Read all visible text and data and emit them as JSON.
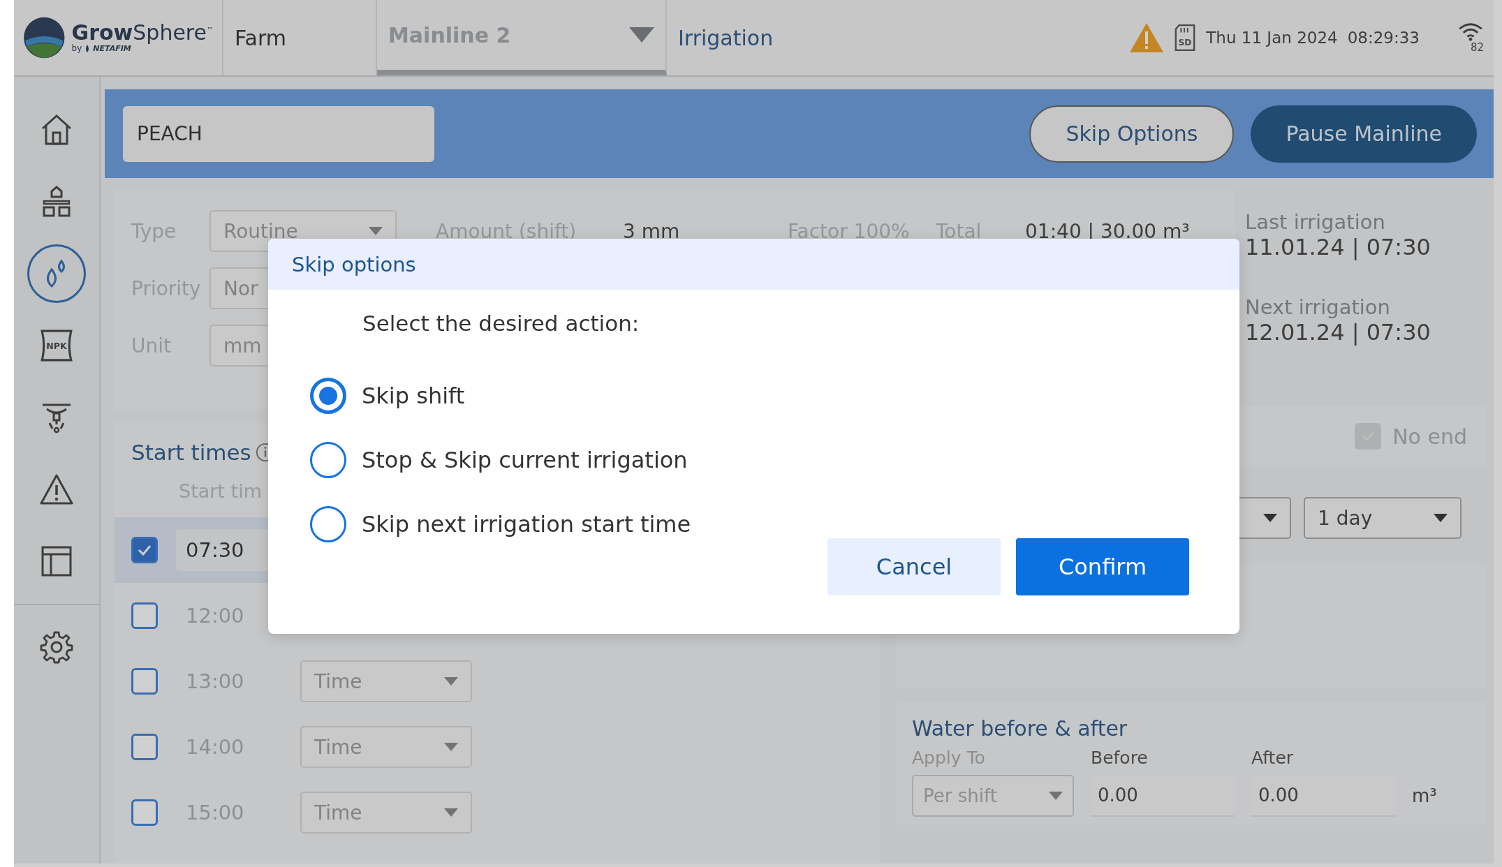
{
  "topbar": {
    "brand": "**Grow**Sphere$^{™}$",
    "brand_by": "by",
    "brand_maker": "NETAFIM",
    "farm": "Farm",
    "mainline": "Mainline 2",
    "section": "Irrigation",
    "alert": true,
    "storage_label": "SD",
    "date": "Thu 11 Jan 2024",
    "time": "08:29:33",
    "signal": "82"
  },
  "sidebar": {
    "items": [
      {
        "kind": "home",
        "selected": false
      },
      {
        "kind": "hierarchy",
        "selected": false
      },
      {
        "kind": "irrigation",
        "selected": true
      },
      {
        "kind": "npk",
        "label": "NPK",
        "selected": false
      },
      {
        "kind": "sprinkler",
        "selected": false
      },
      {
        "kind": "alert",
        "selected": false
      },
      {
        "kind": "table",
        "selected": false
      },
      {
        "kind": "settings",
        "selected": false
      }
    ]
  },
  "header": {
    "program_name": "PEACH",
    "buttons": [
      {
        "label": "Skip Options",
        "kind": "outline"
      },
      {
        "label": "Pause Mainline",
        "kind": "filled"
      }
    ]
  },
  "settings": {
    "fields": [
      {
        "label": "Type",
        "value": "Routine"
      },
      {
        "label": "Priority",
        "value": "Nor"
      },
      {
        "label": "Unit",
        "value": "mm"
      }
    ],
    "amount": {
      "label": "Amount (shift)",
      "value": "3 mm"
    },
    "factor": "Factor 100%",
    "total": {
      "label": "Total",
      "value": "01:40 | 30.00 m³"
    },
    "last_irrigation": {
      "label": "Last irrigation",
      "value": "11.01.24 | 07:30"
    },
    "next_irrigation": {
      "label": "Next irrigation",
      "value": "12.01.24 | 07:30"
    }
  },
  "start_times": {
    "title": "Start times",
    "column": "Start tim",
    "rows": [
      {
        "time": "07:30",
        "checked": true
      },
      {
        "time": "12:00",
        "checked": false
      },
      {
        "time": "13:00",
        "checked": false,
        "mode": "Time"
      },
      {
        "time": "14:00",
        "checked": false,
        "mode": "Time"
      },
      {
        "time": "15:00",
        "checked": false,
        "mode": "Time"
      }
    ]
  },
  "schedule": {
    "no_end": {
      "label": "No end",
      "checked": true,
      "disabled": true
    },
    "interval": "1 day"
  },
  "water": {
    "title": "Water before & after",
    "apply_to": {
      "label": "Apply To",
      "value": "Per shift"
    },
    "before": {
      "label": "Before",
      "value": "0.00"
    },
    "after": {
      "label": "After",
      "value": "0.00"
    },
    "unit": "m³"
  },
  "dialog": {
    "title": "Skip options",
    "prompt": "Select the desired action:",
    "options": [
      {
        "label": "Skip shift",
        "selected": true
      },
      {
        "label": "Stop & Skip current irrigation",
        "selected": false
      },
      {
        "label": "Skip next irrigation start time",
        "selected": false
      }
    ],
    "buttons": [
      {
        "label": "Cancel",
        "kind": "secondary"
      },
      {
        "label": "Confirm",
        "kind": "primary"
      }
    ]
  }
}
